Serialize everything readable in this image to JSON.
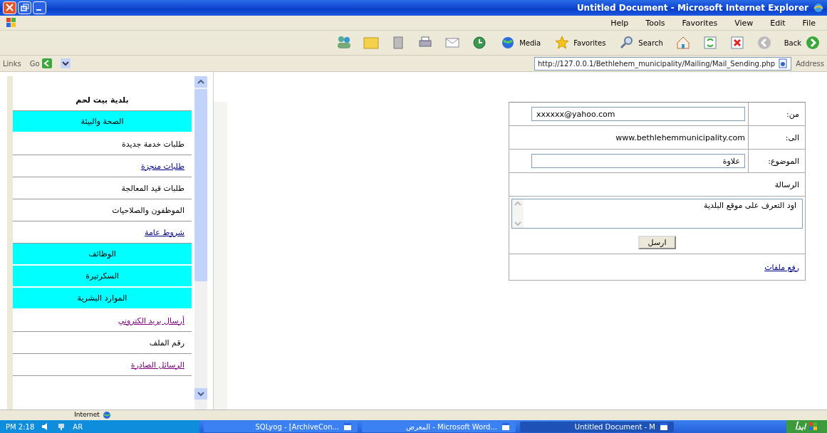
{
  "window": {
    "title": "Untitled Document - Microsoft Internet Explorer"
  },
  "menu": [
    "File",
    "Edit",
    "View",
    "Favorites",
    "Tools",
    "Help"
  ],
  "toolbar": [
    {
      "kind": "back",
      "label": "Back"
    },
    {
      "kind": "forward"
    },
    {
      "kind": "stop"
    },
    {
      "kind": "refresh"
    },
    {
      "kind": "home"
    },
    {
      "kind": "search",
      "label": "Search"
    },
    {
      "kind": "favorites",
      "label": "Favorites"
    },
    {
      "kind": "media",
      "label": "Media"
    },
    {
      "kind": "history"
    },
    {
      "kind": "mail"
    },
    {
      "kind": "print"
    },
    {
      "kind": "edit"
    },
    {
      "kind": "folder"
    },
    {
      "kind": "messenger"
    }
  ],
  "address_bar": {
    "links_label": "Links",
    "go_label": "Go",
    "url": "http://127.0.0.1/Bethlehem_municipality/Mailing/Mail_Sending.php",
    "address_label": "Address"
  },
  "sidebar": {
    "items": [
      {
        "label": "بلدية بيت لحم",
        "kind": "title"
      },
      {
        "label": "الصحة والبيئة",
        "kind": "section"
      },
      {
        "label": "طلبات خدمة جديدة",
        "kind": "plain"
      },
      {
        "label": "طلبات منجزة",
        "kind": "link"
      },
      {
        "label": "طلبات قيد المعالجة",
        "kind": "plain"
      },
      {
        "label": "الموظفون والصلاحيات",
        "kind": "plain"
      },
      {
        "label": "شروط عامة",
        "kind": "link"
      },
      {
        "label": "الوظائف",
        "kind": "section"
      },
      {
        "label": "السكرتيرة",
        "kind": "section"
      },
      {
        "label": "الموارد البشرية",
        "kind": "section"
      },
      {
        "label": "أرسال بريد الكتروني",
        "kind": "visited-link"
      },
      {
        "label": "رقم الملف",
        "kind": "plain"
      },
      {
        "label": "الرسائل الصادرة",
        "kind": "visited-link"
      }
    ]
  },
  "mail_form": {
    "from_label": "من:",
    "from_value": "xxxxxx@yahoo.com",
    "to_label": "الى:",
    "to_value": "www.bethlehemmunicipality.com",
    "subject_label": "الموضوع:",
    "subject_value": "علاوة",
    "message_label": "الرسالة",
    "message_value": "اود التعرف على موقع البلدية",
    "send_button": "ارسل",
    "upload_link": "رفع ملفات"
  },
  "status_bar": {
    "zone": "Internet"
  },
  "taskbar": {
    "clock": "PM 2:18",
    "language": "AR",
    "tasks": [
      {
        "label": "Untitled Document - M",
        "selected": true
      },
      {
        "label": "المعرض - Microsoft Word...",
        "selected": false
      },
      {
        "label": "SQLyog - [ArchiveCon...",
        "selected": false
      }
    ],
    "start": "ابدأ"
  }
}
